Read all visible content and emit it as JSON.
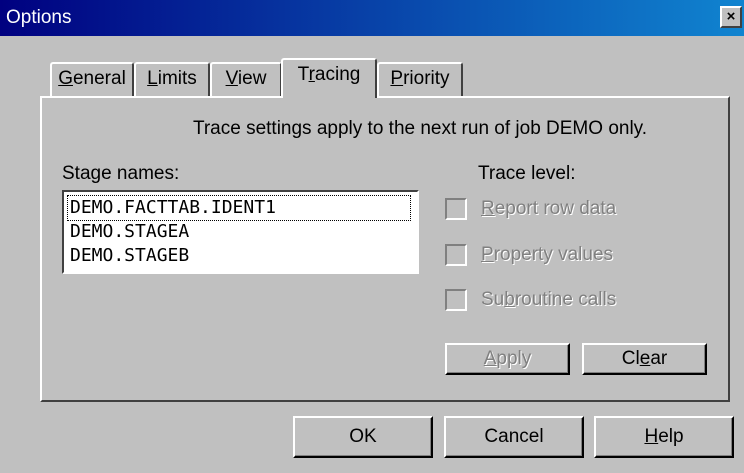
{
  "window": {
    "title": "Options",
    "close_glyph": "×"
  },
  "tabs": [
    {
      "pre": "",
      "mnemonic": "G",
      "post": "eneral"
    },
    {
      "pre": "",
      "mnemonic": "L",
      "post": "imits"
    },
    {
      "pre": "",
      "mnemonic": "V",
      "post": "iew"
    },
    {
      "pre": "T",
      "mnemonic": "r",
      "post": "acing"
    },
    {
      "pre": "",
      "mnemonic": "P",
      "post": "riority"
    }
  ],
  "active_tab": "Tracing",
  "tracing": {
    "info_text": "Trace settings apply to the next run of job DEMO only.",
    "stage_names_label": "Stage names:",
    "stage_names": [
      "DEMO.FACTTAB.IDENT1",
      "DEMO.STAGEA",
      "DEMO.STAGEB"
    ],
    "trace_level_label": "Trace level:",
    "options": [
      {
        "pre": "",
        "mnemonic": "R",
        "post": "eport row data",
        "checked": false,
        "enabled": false
      },
      {
        "pre": "",
        "mnemonic": "P",
        "post": "roperty values",
        "checked": false,
        "enabled": false
      },
      {
        "pre": "Su",
        "mnemonic": "b",
        "post": "routine calls",
        "checked": false,
        "enabled": false
      }
    ],
    "apply": {
      "pre": "",
      "mnemonic": "A",
      "post": "pply",
      "enabled": false
    },
    "clear": {
      "pre": "Cl",
      "mnemonic": "e",
      "post": "ar",
      "enabled": true
    }
  },
  "footer": {
    "ok": "OK",
    "cancel": "Cancel",
    "help": {
      "pre": "",
      "mnemonic": "H",
      "post": "elp"
    }
  },
  "colors": {
    "face": "#c0c0c0",
    "title_start": "#000080",
    "title_end": "#1084d0",
    "disabled_text": "#808080"
  }
}
